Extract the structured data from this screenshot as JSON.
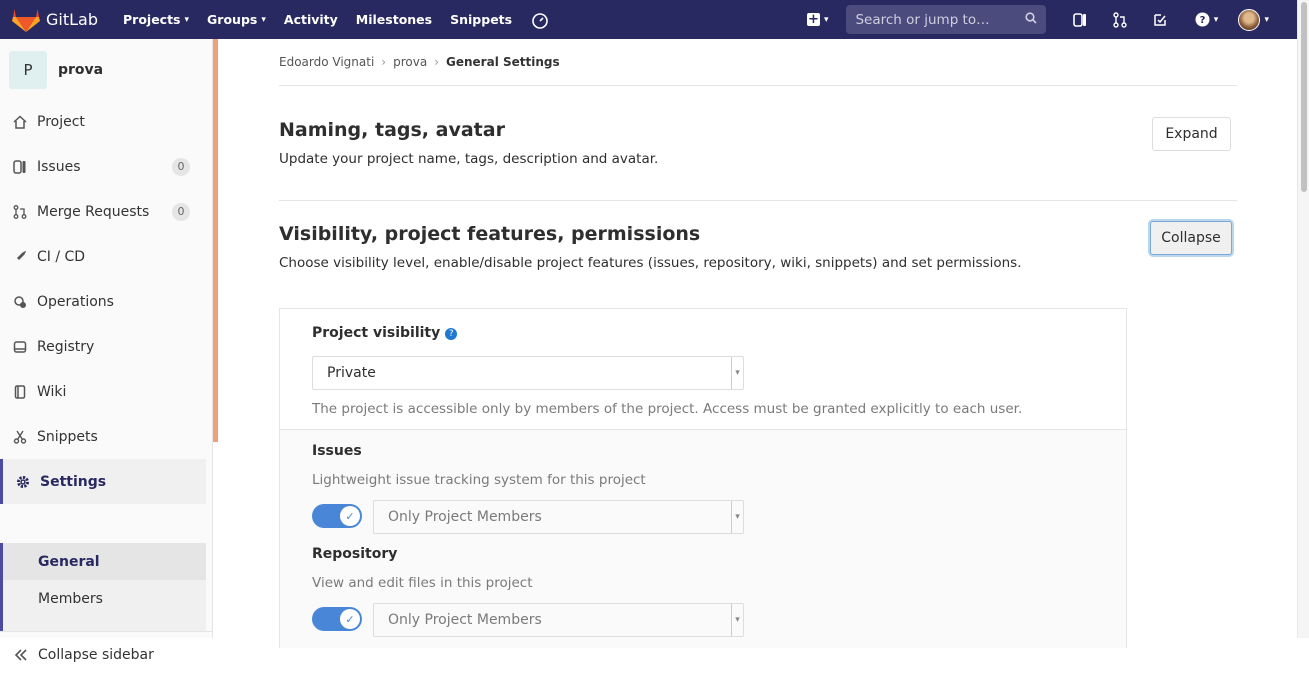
{
  "navbar": {
    "brand": "GitLab",
    "items": [
      {
        "label": "Projects",
        "has_caret": true
      },
      {
        "label": "Groups",
        "has_caret": true
      },
      {
        "label": "Activity"
      },
      {
        "label": "Milestones"
      },
      {
        "label": "Snippets"
      }
    ],
    "search_placeholder": "Search or jump to…",
    "icons": [
      "plus-icon",
      "gauge-icon",
      "issues-icon",
      "merge-request-icon",
      "todo-check-icon",
      "help-icon",
      "avatar"
    ]
  },
  "sidebar": {
    "project_initial": "P",
    "project_name": "prova",
    "items": [
      {
        "label": "Project",
        "icon": "home-icon"
      },
      {
        "label": "Issues",
        "icon": "issues-icon",
        "badge": "0"
      },
      {
        "label": "Merge Requests",
        "icon": "merge-request-icon",
        "badge": "0"
      },
      {
        "label": "CI / CD",
        "icon": "rocket-icon"
      },
      {
        "label": "Operations",
        "icon": "cloud-gear-icon"
      },
      {
        "label": "Registry",
        "icon": "disk-icon"
      },
      {
        "label": "Wiki",
        "icon": "book-icon"
      },
      {
        "label": "Snippets",
        "icon": "scissors-icon"
      },
      {
        "label": "Settings",
        "icon": "gear-icon",
        "active": true
      }
    ],
    "sub_items": [
      {
        "label": "General",
        "active": true
      },
      {
        "label": "Members"
      }
    ],
    "collapse_label": "Collapse sidebar"
  },
  "breadcrumb": [
    "Edoardo Vignati",
    "prova",
    "General Settings"
  ],
  "sections": {
    "naming": {
      "title": "Naming, tags, avatar",
      "description": "Update your project name, tags, description and avatar.",
      "button": "Expand"
    },
    "visibility": {
      "title": "Visibility, project features, permissions",
      "description": "Choose visibility level, enable/disable project features (issues, repository, wiki, snippets) and set permissions.",
      "button": "Collapse"
    }
  },
  "visibility_panel": {
    "label": "Project visibility",
    "selected": "Private",
    "help_text": "The project is accessible only by members of the project. Access must be granted explicitly to each user.",
    "features": [
      {
        "title": "Issues",
        "description": "Lightweight issue tracking system for this project",
        "enabled": true,
        "access": "Only Project Members"
      },
      {
        "title": "Repository",
        "description": "View and edit files in this project",
        "enabled": true,
        "access": "Only Project Members"
      }
    ]
  },
  "colors": {
    "navbar": "#292961",
    "accent": "#f0a17b",
    "toggle": "#4a86d8"
  }
}
